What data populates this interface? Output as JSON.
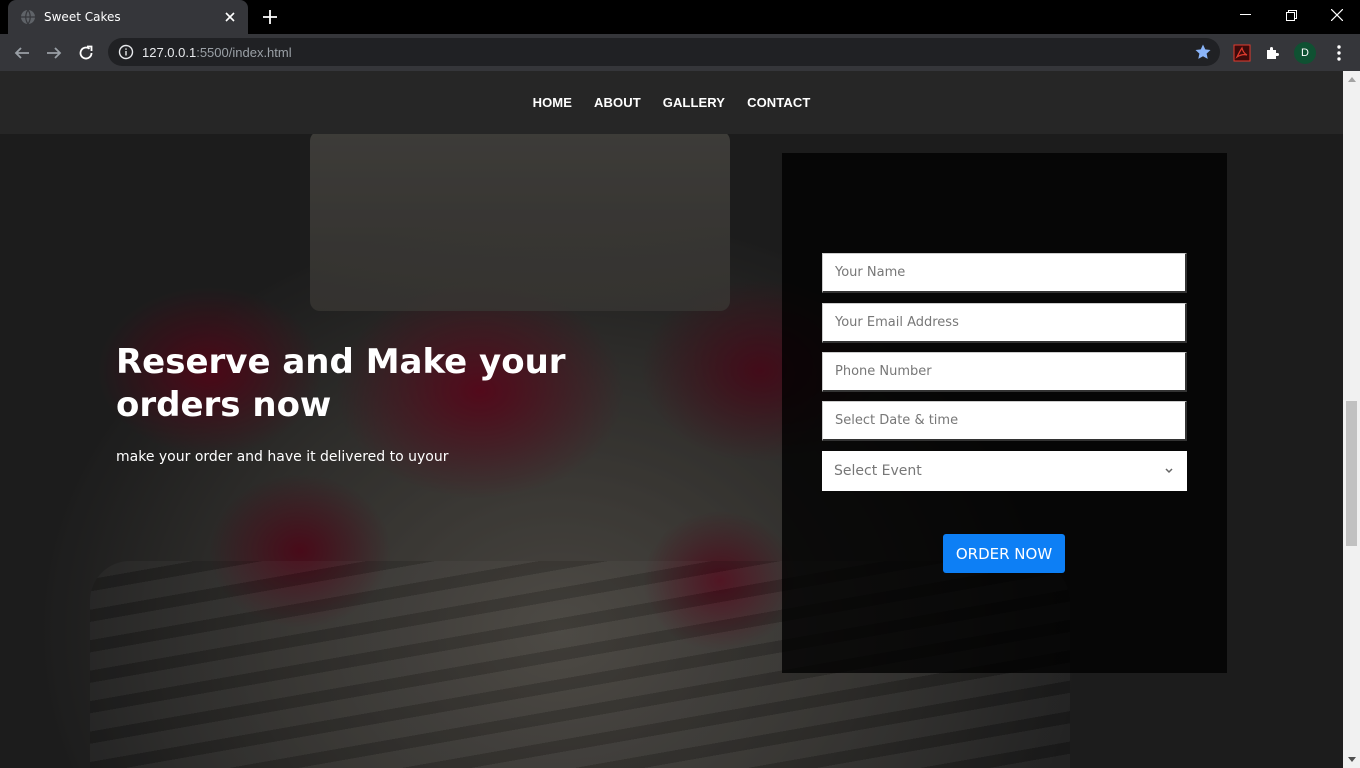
{
  "browser": {
    "tab_title": "Sweet Cakes",
    "url_host": "127.0.0.1",
    "url_rest": ":5500/index.html",
    "profile_initial": "D"
  },
  "nav": {
    "items": [
      "HOME",
      "ABOUT",
      "GALLERY",
      "CONTACT"
    ]
  },
  "hero": {
    "headline": "Reserve and Make your orders now",
    "subline": "make your order and have it delivered to uyour"
  },
  "form": {
    "name_placeholder": "Your Name",
    "email_placeholder": "Your Email Address",
    "phone_placeholder": "Phone Number",
    "datetime_placeholder": "Select Date & time",
    "event_selected": "Select Event",
    "order_label": "ORDER NOW"
  },
  "colors": {
    "accent_button": "#0d7ff5",
    "nav_bg": "#262626"
  }
}
